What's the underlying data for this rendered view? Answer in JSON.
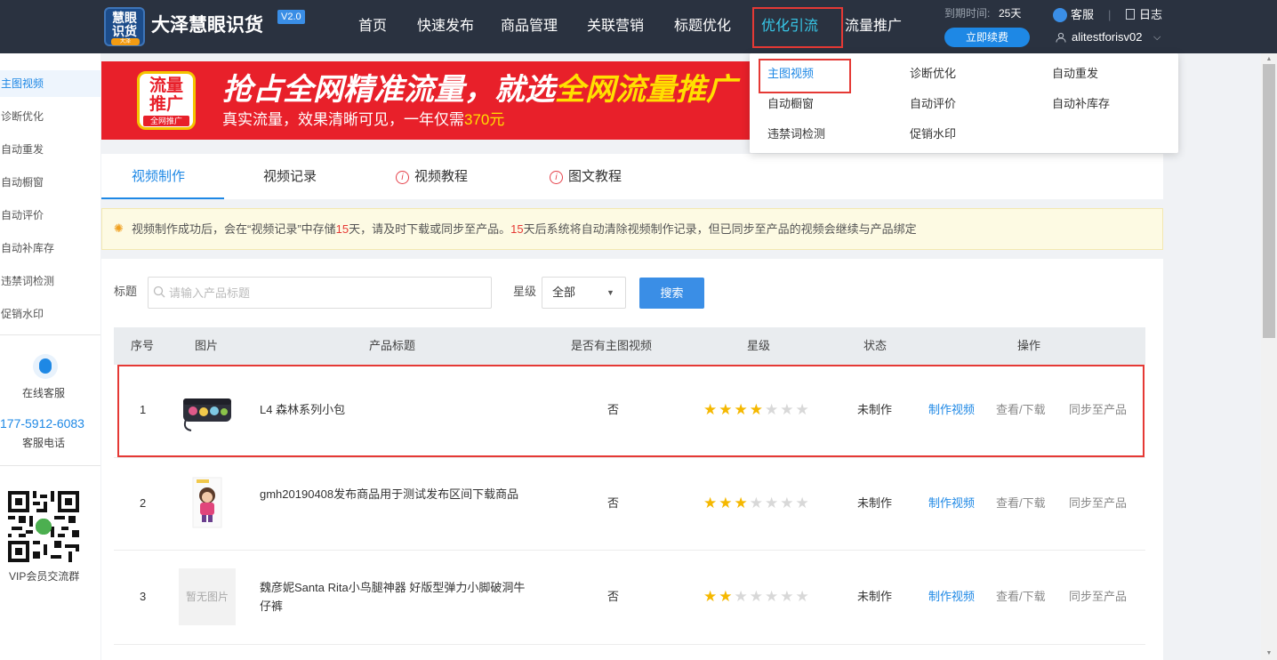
{
  "app": {
    "logo_line1": "慧眼",
    "logo_line2": "识货",
    "logo_tag": "大泽",
    "brand": "大泽慧眼识货",
    "version": "V2.0"
  },
  "nav": [
    {
      "label": "首页"
    },
    {
      "label": "快速发布"
    },
    {
      "label": "商品管理"
    },
    {
      "label": "关联营销"
    },
    {
      "label": "标题优化"
    },
    {
      "label": "优化引流",
      "active": true
    },
    {
      "label": "流量推广"
    }
  ],
  "account": {
    "expire_label": "到期时间:",
    "expire_value": "25天",
    "renew_label": "立即续费",
    "service_label": "客服",
    "separator": "|",
    "log_label": "日志",
    "username": "alitestforisv02"
  },
  "dropdown": [
    {
      "label": "主图视频",
      "active": true
    },
    {
      "label": "诊断优化"
    },
    {
      "label": "自动重发"
    },
    {
      "label": "自动橱窗"
    },
    {
      "label": "自动评价"
    },
    {
      "label": "自动补库存"
    },
    {
      "label": "违禁词检测"
    },
    {
      "label": "促销水印"
    }
  ],
  "sidebar": {
    "items": [
      {
        "label": "主图视频",
        "active": true
      },
      {
        "label": "诊断优化"
      },
      {
        "label": "自动重发"
      },
      {
        "label": "自动橱窗"
      },
      {
        "label": "自动评价"
      },
      {
        "label": "自动补库存"
      },
      {
        "label": "违禁词检测"
      },
      {
        "label": "促销水印"
      }
    ],
    "online_service": "在线客服",
    "phone": "177-5912-6083",
    "phone_label": "客服电话",
    "vip_group": "VIP会员交流群"
  },
  "banner": {
    "badge_line1": "流量",
    "badge_line2": "推广",
    "badge_tag": "全网推广",
    "headline_main": "抢占全网精准流量，就选",
    "headline_highlight": "全网流量推广",
    "sub_main": "真实流量，效果清晰可见，一年仅需",
    "sub_price": "370元"
  },
  "tabs": [
    {
      "label": "视频制作",
      "active": true
    },
    {
      "label": "视频记录"
    },
    {
      "label": "视频教程",
      "info": true
    },
    {
      "label": "图文教程",
      "info": true
    }
  ],
  "notice": {
    "icon": "bulb-icon",
    "part1": "视频制作成功后，会在“视频记录”中存储",
    "days1": "15",
    "part2": "天，请及时下载或同步至产品。",
    "days2": "15",
    "part3": "天后系统将自动清除视频制作记录，但已同步至产品的视频会继续与产品绑定"
  },
  "filter": {
    "title_label": "标题",
    "title_placeholder": "请输入产品标题",
    "star_label": "星级",
    "star_value": "全部",
    "search_button": "搜索"
  },
  "table": {
    "headers": [
      "序号",
      "图片",
      "产品标题",
      "是否有主图视频",
      "星级",
      "状态",
      "操作"
    ],
    "rows": [
      {
        "index": "1",
        "image": "bag-thumbnail",
        "title": "L4 森林系列小包",
        "has_video": "否",
        "stars": 4,
        "max_stars": 7,
        "status": "未制作",
        "action_make": "制作视频",
        "action_view": "查看/下载",
        "action_sync": "同步至产品"
      },
      {
        "index": "2",
        "image": "doll-thumbnail",
        "title": "gmh20190408发布商品用于测试发布区间下载商品",
        "has_video": "否",
        "stars": 3,
        "max_stars": 7,
        "status": "未制作",
        "action_make": "制作视频",
        "action_view": "查看/下载",
        "action_sync": "同步至产品"
      },
      {
        "index": "3",
        "image": "no-image",
        "image_text": "暂无图片",
        "title": "魏彦妮Santa Rita小鸟腿神器 好版型弹力小脚破洞牛仔裤",
        "has_video": "否",
        "stars": 2,
        "max_stars": 7,
        "status": "未制作",
        "action_make": "制作视频",
        "action_view": "查看/下载",
        "action_sync": "同步至产品"
      }
    ]
  },
  "colors": {
    "header_bg": "#2a3240",
    "accent": "#1e88e5",
    "highlight_border": "#e53935",
    "star_on": "#f5b800",
    "banner_bg": "#e8202a"
  }
}
